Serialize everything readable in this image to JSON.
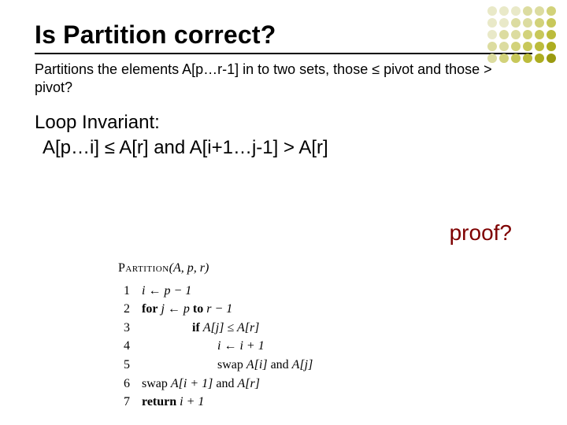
{
  "title": "Is Partition correct?",
  "subtext": "Partitions the elements A[p…r-1] in to two sets, those ≤ pivot and those > pivot?",
  "loop_head": "Loop Invariant:",
  "loop_expr": "A[p…i] ≤ A[r] and A[i+1…j-1] > A[r]",
  "proof": "proof?",
  "pseudo": {
    "name": "Partition",
    "args": "(A, p, r)",
    "lines": [
      {
        "n": "1",
        "indent": 0,
        "text": "i ← p − 1"
      },
      {
        "n": "2",
        "indent": 0,
        "text": "for j ← p to r − 1",
        "kw_for": true
      },
      {
        "n": "3",
        "indent": 2,
        "text": "if A[j] ≤ A[r]",
        "kw_if": true
      },
      {
        "n": "4",
        "indent": 3,
        "text": "i ← i + 1"
      },
      {
        "n": "5",
        "indent": 3,
        "text": "swap A[i] and A[j]"
      },
      {
        "n": "6",
        "indent": 0,
        "text": "swap A[i + 1] and A[r]"
      },
      {
        "n": "7",
        "indent": 0,
        "text": "return i + 1",
        "kw_return": true
      }
    ]
  },
  "dot_colors": [
    "#e9e9c8",
    "#e9e9c8",
    "#e9e9c8",
    "#dcdca0",
    "#dcdca0",
    "#d2d27a",
    "#e9e9c8",
    "#e9e9c8",
    "#dcdca0",
    "#dcdca0",
    "#d2d27a",
    "#c8c85a",
    "#e9e9c8",
    "#dcdca0",
    "#dcdca0",
    "#d2d27a",
    "#c8c85a",
    "#bcbc3c",
    "#dcdca0",
    "#dcdca0",
    "#d2d27a",
    "#c8c85a",
    "#bcbc3c",
    "#adad20",
    "#dcdca0",
    "#d2d27a",
    "#c8c85a",
    "#bcbc3c",
    "#adad20",
    "#9a9a10"
  ]
}
